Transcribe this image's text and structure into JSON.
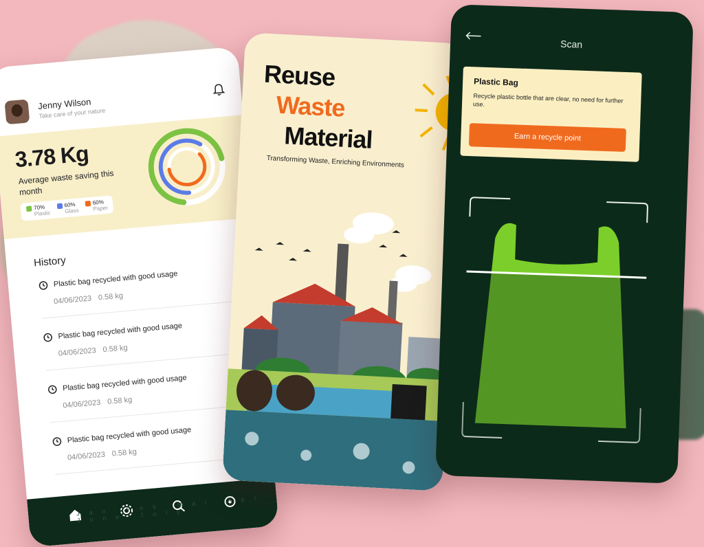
{
  "profile": {
    "name": "Jenny Wilson",
    "tagline": "Take care of your nature"
  },
  "summary": {
    "amount": "3.78 Kg",
    "caption": "Average waste saving this month"
  },
  "legend": [
    {
      "value": "70%",
      "label": "Plastic",
      "color": "#7cc243"
    },
    {
      "value": "60%",
      "label": "Glass",
      "color": "#5b7be6"
    },
    {
      "value": "60%",
      "label": "Paper",
      "color": "#f06a1e"
    }
  ],
  "history": {
    "title": "History",
    "items": [
      {
        "title": "Plastic bag recycled with good usage",
        "date": "04/06/2023",
        "weight": "0.58 kg"
      },
      {
        "title": "Plastic bag recycled with good usage",
        "date": "04/06/2023",
        "weight": "0.58 kg"
      },
      {
        "title": "Plastic bag recycled with good usage",
        "date": "04/06/2023",
        "weight": "0.58 kg"
      },
      {
        "title": "Plastic bag recycled with good usage",
        "date": "04/06/2023",
        "weight": "0.58 kg"
      }
    ]
  },
  "nav": {
    "months": "Jan Feb Mar Apr June July"
  },
  "promo": {
    "line1": "Reuse",
    "line2": "Waste",
    "line3": "Material",
    "subtitle": "Transforming Waste, Enriching Environments"
  },
  "scan": {
    "title": "Scan",
    "card_title": "Plastic Bag",
    "card_text": "Recycle plastic bottle that are clear, no need for further use.",
    "button": "Earn a recycle point"
  }
}
